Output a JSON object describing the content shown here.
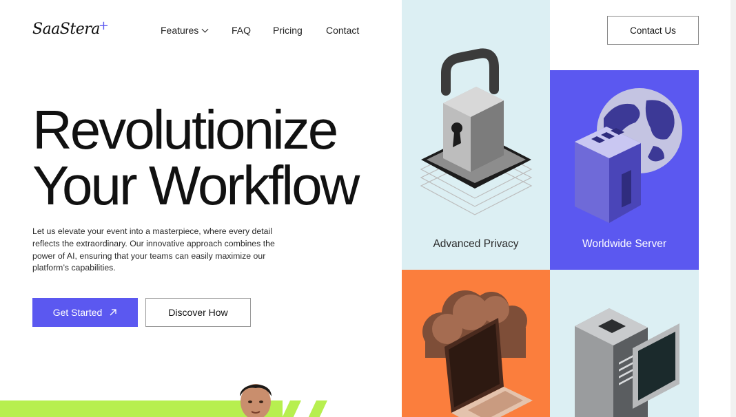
{
  "brand": {
    "logo_text": "SaaStera",
    "logo_mark": "+"
  },
  "nav": {
    "items": [
      {
        "label": "Features",
        "has_dropdown": true
      },
      {
        "label": "FAQ"
      },
      {
        "label": "Pricing"
      },
      {
        "label": "Contact"
      }
    ],
    "cta_label": "Contact Us"
  },
  "hero": {
    "headline_line1": "Revolutionize",
    "headline_line2": "Your Workflow",
    "description": "Let us elevate your event into a masterpiece, where every detail reflects the extraordinary. Our innovative approach combines the power of AI, ensuring that your teams can easily maximize our platform’s capabilities.",
    "primary_button": "Get Started",
    "primary_icon": "arrow-up-right-icon",
    "secondary_button": "Discover How"
  },
  "features": [
    {
      "caption": "Advanced Privacy",
      "icon": "padlock-icon"
    },
    {
      "caption": "Worldwide Server",
      "icon": "globe-server-icon"
    },
    {
      "caption": "",
      "icon": "cloud-laptop-icon"
    },
    {
      "caption": "",
      "icon": "server-tower-icon"
    }
  ],
  "colors": {
    "accent": "#5b58f0",
    "lime": "#b7ef4f",
    "orange": "#fb7e3d",
    "pale_blue": "#dceff3"
  }
}
